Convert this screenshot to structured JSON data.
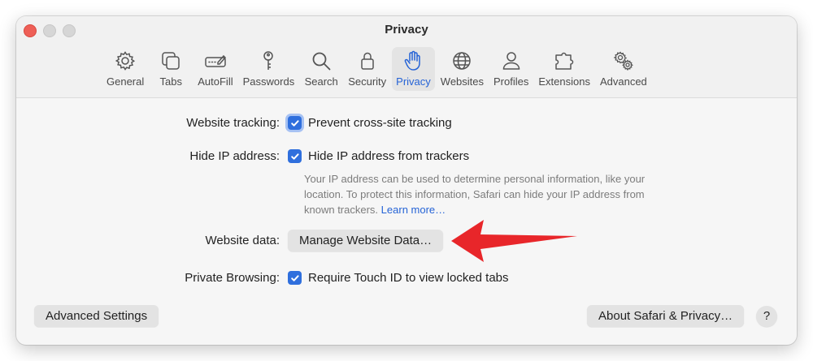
{
  "window": {
    "title": "Privacy"
  },
  "toolbar": {
    "items": [
      {
        "label": "General",
        "icon": "gear-icon",
        "active": false
      },
      {
        "label": "Tabs",
        "icon": "tabs-icon",
        "active": false
      },
      {
        "label": "AutoFill",
        "icon": "autofill-icon",
        "active": false
      },
      {
        "label": "Passwords",
        "icon": "key-icon",
        "active": false
      },
      {
        "label": "Search",
        "icon": "search-icon",
        "active": false
      },
      {
        "label": "Security",
        "icon": "lock-icon",
        "active": false
      },
      {
        "label": "Privacy",
        "icon": "hand-icon",
        "active": true
      },
      {
        "label": "Websites",
        "icon": "globe-icon",
        "active": false
      },
      {
        "label": "Profiles",
        "icon": "person-icon",
        "active": false
      },
      {
        "label": "Extensions",
        "icon": "puzzle-icon",
        "active": false
      },
      {
        "label": "Advanced",
        "icon": "gears-icon",
        "active": false
      }
    ]
  },
  "privacy": {
    "website_tracking": {
      "label": "Website tracking:",
      "checkbox_label": "Prevent cross-site tracking",
      "checked": true
    },
    "hide_ip": {
      "label": "Hide IP address:",
      "checkbox_label": "Hide IP address from trackers",
      "checked": true,
      "help_text": "Your IP address can be used to determine personal information, like your location. To protect this information, Safari can hide your IP address from known trackers.",
      "help_link": "Learn more…"
    },
    "website_data": {
      "label": "Website data:",
      "button_label": "Manage Website Data…"
    },
    "private_browsing": {
      "label": "Private Browsing:",
      "checkbox_label": "Require Touch ID to view locked tabs",
      "checked": true
    }
  },
  "footer": {
    "advanced_settings": "Advanced Settings",
    "about": "About Safari & Privacy…",
    "help": "?"
  },
  "colors": {
    "accent": "#2563d6",
    "checkbox": "#2f6fdd",
    "arrow": "#e8262a"
  }
}
